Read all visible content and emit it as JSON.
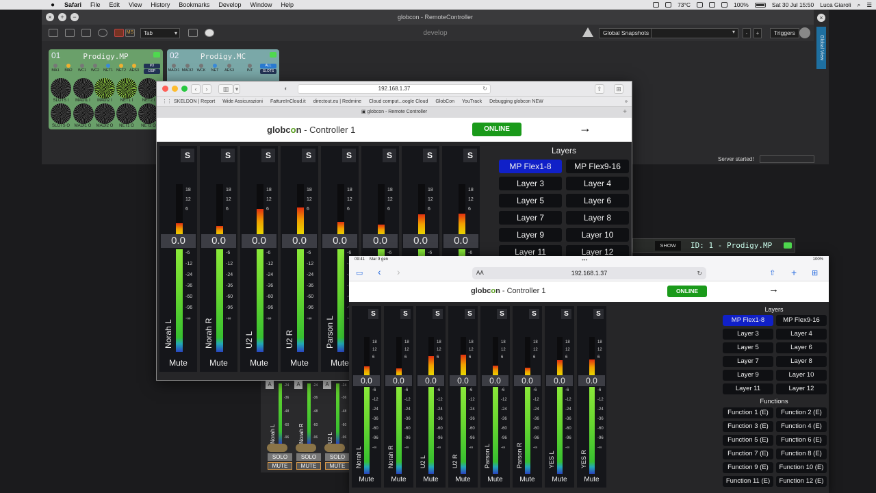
{
  "menubar": {
    "app_name": "Safari",
    "items": [
      "File",
      "Edit",
      "View",
      "History",
      "Bookmarks",
      "Develop",
      "Window",
      "Help"
    ],
    "temperature": "73°C",
    "battery": "100%",
    "datetime": "Sat 30 Jul  15:50",
    "user": "Luca Giaroli"
  },
  "app": {
    "title": "globcon - RemoteController",
    "tab_select": "Tab",
    "mode": "develop",
    "global_snapshots_label": "Global Snapshots",
    "minus": "-",
    "plus": "+",
    "triggers_label": "Triggers",
    "global_view_label": "Global View",
    "status": "Server started!",
    "devices": [
      {
        "num": "01",
        "name": "Prodigy.MP",
        "indicators": [
          "MA1",
          "MA2",
          "WC1",
          "WC2",
          "NET1",
          "NET2",
          "AES3"
        ],
        "badge1": "I/O",
        "badge2": "DSP",
        "row1": [
          "SLOTS I",
          "MADI1 I",
          "MADI2 I",
          "NET1 I",
          "NET2 I"
        ],
        "row2": [
          "SLOTS O",
          "MADI1 O",
          "MADI2 O",
          "NET1 O",
          "NET2 O"
        ]
      },
      {
        "num": "02",
        "name": "Prodigy.MC",
        "indicators": [
          "MADI1",
          "MADI2",
          "WCK",
          "NET",
          "AES3",
          "INT"
        ],
        "badge1": "ALL",
        "badge2": "SLOTS"
      }
    ],
    "id_bar": {
      "show_label": "SHOW",
      "id_text": "ID: 1 - Prodigy.MP"
    },
    "bg_mixer": [
      {
        "name": "Norah L",
        "solo": "SOLO",
        "mute": "MUTE",
        "a": "A"
      },
      {
        "name": "Norah R",
        "solo": "SOLO",
        "mute": "MUTE",
        "a": "A"
      },
      {
        "name": "U2 L",
        "solo": "SOLO",
        "mute": "MUTE",
        "a": "A"
      }
    ],
    "bg_scale": [
      "-24",
      "-36",
      "-48",
      "-60",
      "-96"
    ]
  },
  "safari": {
    "url": "192.168.1.37",
    "bookmarks": [
      "SKELDON | Report",
      "Wide Assicurazioni",
      "FattureInCloud.it",
      "directout.eu | Redmine",
      "Cloud comput...oogle Cloud",
      "GlobCon",
      "YouTrack",
      "Debugging globcon NEW"
    ],
    "tab_title": "globcon - Remote Controller",
    "logo_main": "globc",
    "logo_o": "o",
    "logo_n": "n",
    "logo_suffix": " - Controller 1",
    "status": "ONLINE",
    "arrow": "→",
    "strips": [
      {
        "name": "Norah L",
        "value": "0.0",
        "level": 0.25
      },
      {
        "name": "Norah R",
        "value": "0.0",
        "level": 0.2
      },
      {
        "name": "U2 L",
        "value": "0.0",
        "level": 0.52
      },
      {
        "name": "U2 R",
        "value": "0.0",
        "level": 0.55
      },
      {
        "name": "Parson L",
        "value": "0.0",
        "level": 0.28
      },
      {
        "name": "Parson R",
        "value": "0.0",
        "level": 0.23
      },
      {
        "name": "YES L",
        "value": "0.0",
        "level": 0.42
      },
      {
        "name": "YES R",
        "value": "0.0",
        "level": 0.43
      }
    ],
    "scale_top": [
      "18",
      "12",
      "6"
    ],
    "scale_bottom": [
      "-6",
      "-12",
      "-24",
      "-36",
      "-60",
      "-96",
      "-∞"
    ],
    "solo_label": "S",
    "mute_label": "Mute",
    "layers_title": "Layers",
    "layers": [
      "MP Flex1-8",
      "MP Flex9-16",
      "Layer 3",
      "Layer 4",
      "Layer 5",
      "Layer 6",
      "Layer 7",
      "Layer 8",
      "Layer 9",
      "Layer 10",
      "Layer 11",
      "Layer 12"
    ]
  },
  "ipad": {
    "time": "09:41",
    "date": "Mar 9 gen",
    "battery": "100%",
    "aa": "AA",
    "url": "192.168.1.37",
    "functions_title": "Functions",
    "functions": [
      "Function 1 (E)",
      "Function 2 (E)",
      "Function 3 (E)",
      "Function 4 (E)",
      "Function 5 (E)",
      "Function 6 (E)",
      "Function 7 (E)",
      "Function 8 (E)",
      "Function 9 (E)",
      "Function 10 (E)",
      "Function 11 (E)",
      "Function 12 (E)"
    ]
  },
  "colors": {
    "online": "#1a9a1a",
    "active_layer": "#1020c8",
    "meter_green": "#6ad830"
  }
}
